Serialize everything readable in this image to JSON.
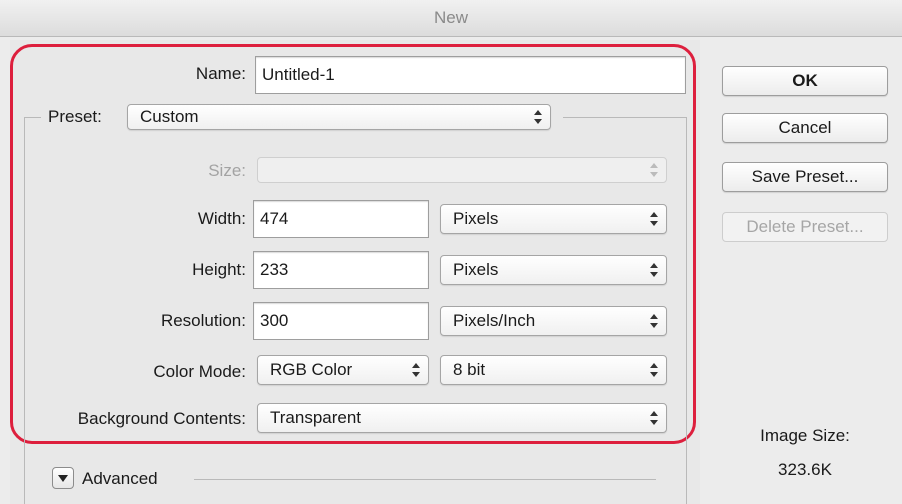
{
  "window": {
    "title": "New"
  },
  "form": {
    "name": {
      "label": "Name:",
      "value": "Untitled-1"
    },
    "preset": {
      "label": "Preset:",
      "value": "Custom"
    },
    "size": {
      "label": "Size:",
      "value": ""
    },
    "width": {
      "label": "Width:",
      "value": "474",
      "unit": "Pixels"
    },
    "height": {
      "label": "Height:",
      "value": "233",
      "unit": "Pixels"
    },
    "resolution": {
      "label": "Resolution:",
      "value": "300",
      "unit": "Pixels/Inch"
    },
    "color_mode": {
      "label": "Color Mode:",
      "mode": "RGB Color",
      "depth": "8 bit"
    },
    "background": {
      "label": "Background Contents:",
      "value": "Transparent"
    },
    "advanced": {
      "label": "Advanced"
    }
  },
  "buttons": {
    "ok": "OK",
    "cancel": "Cancel",
    "save_preset": "Save Preset...",
    "delete_preset": "Delete Preset..."
  },
  "image_size": {
    "label": "Image Size:",
    "value": "323.6K"
  },
  "colors": {
    "highlight": "#dd1f3d"
  }
}
